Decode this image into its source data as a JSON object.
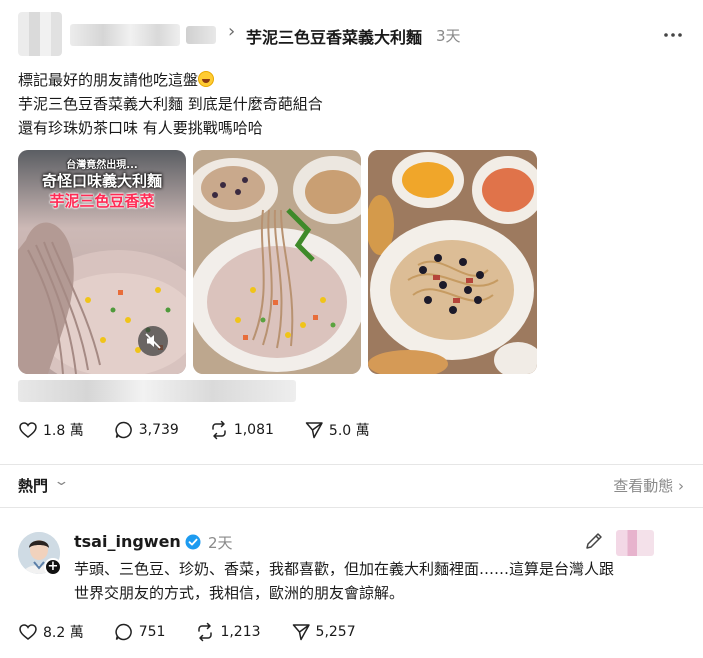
{
  "post": {
    "topic": "芋泥三色豆香菜義大利麵",
    "time": "3天",
    "lines": [
      "標記最好的朋友請他吃這盤",
      "芋泥三色豆香菜義大利麵 到底是什麼奇葩組合",
      "還有珍珠奶茶口味 有人要挑戰嗎哈哈"
    ],
    "emoji": "grinning-sweat-emoji",
    "video_overlay": {
      "line1": "台灣竟然出現...",
      "line2": "奇怪口味義大利麵",
      "line3": "芋泥三色豆香菜"
    },
    "stats": {
      "likes": "1.8 萬",
      "comments": "3,739",
      "reposts": "1,081",
      "shares": "5.0 萬"
    }
  },
  "sort": {
    "label": "熱門",
    "view_activity": "查看動態"
  },
  "reply": {
    "username": "tsai_ingwen",
    "time": "2天",
    "lines": [
      "芋頭、三色豆、珍奶、香菜，我都喜歡，但加在義大利麵裡面……這算是台灣人跟",
      "世界交朋友的方式，我相信，歐洲的朋友會諒解。"
    ],
    "stats": {
      "likes": "8.2 萬",
      "comments": "751",
      "reposts": "1,213",
      "shares": "5,257"
    }
  },
  "colors": {
    "verified": "#1d9bf0",
    "muted_text": "#8a8a8a",
    "divider": "#e6e6e6"
  }
}
